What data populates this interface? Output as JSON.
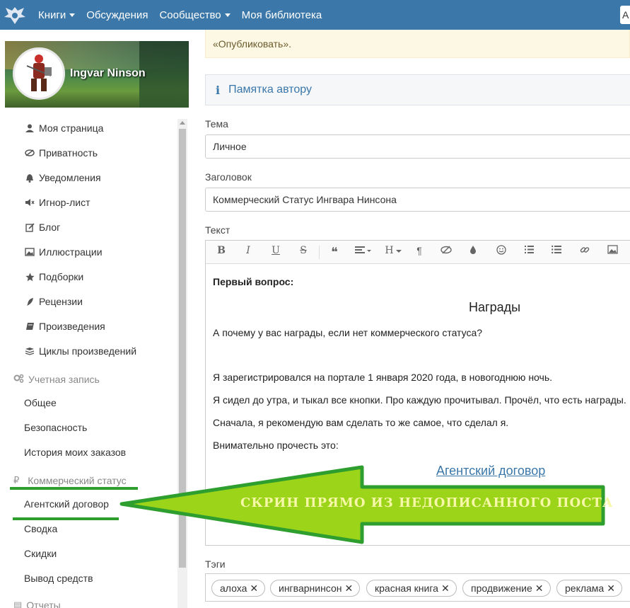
{
  "nav": {
    "items": [
      {
        "label": "Книги",
        "dropdown": true
      },
      {
        "label": "Обсуждения",
        "dropdown": false
      },
      {
        "label": "Сообщество",
        "dropdown": true
      },
      {
        "label": "Моя библиотека",
        "dropdown": false
      }
    ],
    "right_button": "А"
  },
  "profile": {
    "name": "Ingvar Ninson"
  },
  "sidebar": {
    "items": [
      {
        "label": "Моя страница",
        "icon": "user-icon"
      },
      {
        "label": "Приватность",
        "icon": "eye-slash-icon"
      },
      {
        "label": "Уведомления",
        "icon": "bell-icon"
      },
      {
        "label": "Игнор-лист",
        "icon": "mute-icon"
      },
      {
        "label": "Блог",
        "icon": "edit-icon"
      },
      {
        "label": "Иллюстрации",
        "icon": "image-icon"
      },
      {
        "label": "Подборки",
        "icon": "star-icon"
      },
      {
        "label": "Рецензии",
        "icon": "quill-icon"
      },
      {
        "label": "Произведения",
        "icon": "book-icon"
      },
      {
        "label": "Циклы произведений",
        "icon": "stack-icon"
      }
    ],
    "account_head": "Учетная запись",
    "account_items": [
      "Общее",
      "Безопасность",
      "История моих заказов"
    ],
    "commercial_head": "Коммерческий статус",
    "commercial_items": [
      "Агентский договор",
      "Сводка",
      "Скидки",
      "Вывод средств"
    ],
    "reports_head": "Отчеты"
  },
  "main": {
    "notice": "«Опубликовать».",
    "memo": "Памятка автору",
    "topic_label": "Тема",
    "topic_value": "Личное",
    "title_label": "Заголовок",
    "title_value": "Коммерческий Статус Ингвара Нинсона",
    "text_label": "Текст",
    "toolbar": {
      "bold": "B",
      "italic": "I",
      "underline": "U",
      "strike": "S",
      "quote": "❝",
      "heading": "H",
      "paragraph": "¶"
    },
    "content": {
      "first_question": "Первый вопрос:",
      "awards_title": "Награды",
      "line1": "А почему у вас награды, если нет коммерческого статуса?",
      "line2": "Я зарегистрировался на портале 1 января 2020 года, в новогоднюю ночь.",
      "line3": "Я сидел до утра, и тыкал все кнопки. Про каждую прочитывал. Прочёл, что есть награды.",
      "line4": "Сначала, я рекомендую вам сделать то же самое, что сделал я.",
      "line5": "Внимательно прочесть это:",
      "link": "Агентский договор"
    },
    "tags_label": "Тэги",
    "tags": [
      "алоха",
      "ингварнинсон",
      "красная книга",
      "продвижение",
      "реклама"
    ]
  },
  "annotation": {
    "text": "СКРИН ПРЯМО ИЗ НЕДОПИСАННОГО ПОСТА",
    "arrow_color": "#2e9e2e",
    "fill_color": "#9cd41a"
  }
}
